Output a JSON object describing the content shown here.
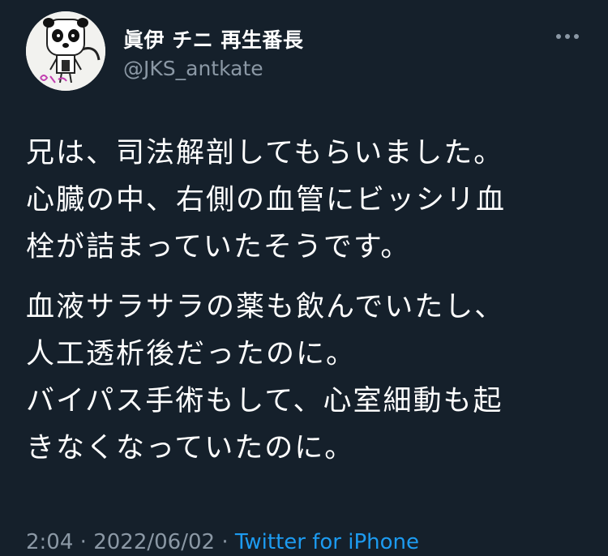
{
  "author": {
    "display_name": "眞伊 チニ 再生番長",
    "handle": "@JKS_antkate",
    "avatar_icon": "panda-avatar-icon"
  },
  "tweet": {
    "paragraphs": [
      [
        "兄は、司法解剖してもらいました。",
        "心臓の中、右側の血管にビッシリ血",
        "栓が詰まっていたそうです。"
      ],
      [
        "血液サラサラの薬も飲んでいたし、",
        "人工透析後だったのに。",
        "バイパス手術もして、心室細動も起",
        "きなくなっていたのに。"
      ]
    ]
  },
  "meta": {
    "time": "2:04",
    "separator": "·",
    "date": "2022/06/02",
    "source": "Twitter for iPhone"
  },
  "colors": {
    "background": "#15202b",
    "text": "#ffffff",
    "secondary": "#8b98a5",
    "link": "#1d9bf0"
  }
}
